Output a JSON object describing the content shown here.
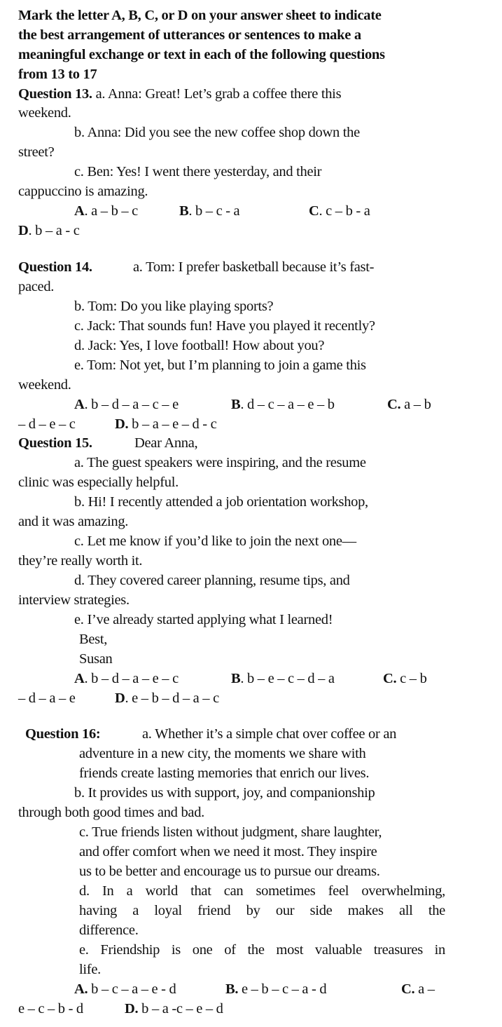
{
  "instructions": [
    "Mark the letter A, B, C, or D on your answer sheet to indicate",
    "the best arrangement of utterances or sentences to make a",
    "meaningful exchange or text in each of the following questions",
    "from 13 to 17"
  ],
  "q13": {
    "label": "Question 13.",
    "a1": "a. Anna: Great! Let’s grab a coffee there this",
    "a2": "weekend.",
    "b1": "b. Anna: Did you see the new coffee shop down the",
    "b2": "street?",
    "c1": "c. Ben: Yes! I went there yesterday, and their",
    "c2": "cappuccino is amazing.",
    "options": {
      "A": {
        "letter": "A",
        "text": ". a – b – c"
      },
      "B": {
        "letter": "B",
        "text": ". b – c - a"
      },
      "C": {
        "letter": "C",
        "text": ". c – b - a"
      },
      "D": {
        "letter": "D",
        "text": ". b – a - c"
      }
    }
  },
  "q14": {
    "label": "Question 14.",
    "a1": "a. Tom: I prefer basketball because it’s fast-",
    "a2": "paced.",
    "b": "b. Tom: Do you like playing sports?",
    "c": "c. Jack: That sounds fun! Have you played it recently?",
    "d": "d. Jack: Yes, I love football! How about you?",
    "e1": "e. Tom: Not yet, but I’m planning to join a game this",
    "e2": "weekend.",
    "options": {
      "A": {
        "letter": "A",
        "text": ". b – d – a – c – e"
      },
      "B": {
        "letter": "B",
        "text": ". d – c – a – e – b"
      },
      "C": {
        "letter": "C.",
        "text": " a – b"
      },
      "C_cont": "– d – e – c",
      "D": {
        "letter": "D.",
        "text": " b – a – e – d - c"
      }
    }
  },
  "q15": {
    "label": "Question 15.",
    "greeting": "Dear Anna,",
    "a1": "a. The guest speakers were inspiring, and the resume",
    "a2": "clinic was especially helpful.",
    "b1": "b. Hi! I recently attended a job orientation workshop,",
    "b2": "and it was amazing.",
    "c1": "c. Let me know if you’d like to join the next one—",
    "c2": "they’re really worth it.",
    "d1": "d. They covered career planning, resume tips, and",
    "d2": "interview strategies.",
    "e": "e. I’ve already started applying what I learned!",
    "closing": "Best,",
    "signature": "Susan",
    "options": {
      "A": {
        "letter": "A",
        "text": ". b – d – a – e – c"
      },
      "B": {
        "letter": "B",
        "text": ". b – e – c – d – a"
      },
      "C": {
        "letter": "C.",
        "text": " c – b"
      },
      "C_cont": "– d – a – e",
      "D": {
        "letter": "D",
        "text": ". e – b – d – a – c"
      }
    }
  },
  "q16": {
    "label": "Question 16:",
    "a1": "a. Whether it’s a simple chat over coffee or an",
    "a2": "adventure in a new city, the moments we share with",
    "a3": "friends create lasting memories that enrich our lives.",
    "b1": "b. It provides us with support, joy, and companionship",
    "b2": "through both good times and bad.",
    "c1": "c. True friends listen without judgment, share laughter,",
    "c2": "and offer comfort when we need it most. They inspire",
    "c3": "us to be better and encourage us to pursue our dreams.",
    "d1": "d. In a world that can sometimes feel overwhelming,",
    "d2": "having a loyal friend by our side makes all the",
    "d3": "difference.",
    "e1": "e. Friendship is one of the most valuable treasures in",
    "e2": "life.",
    "options": {
      "A": {
        "letter": "A.",
        "text": " b – c – a – e - d"
      },
      "B": {
        "letter": "B.",
        "text": " e – b – c – a - d"
      },
      "C": {
        "letter": "C.",
        "text": " a –"
      },
      "C_cont": "e – c – b - d",
      "D": {
        "letter": "D.",
        "text": " b – a -c – e – d"
      }
    }
  }
}
